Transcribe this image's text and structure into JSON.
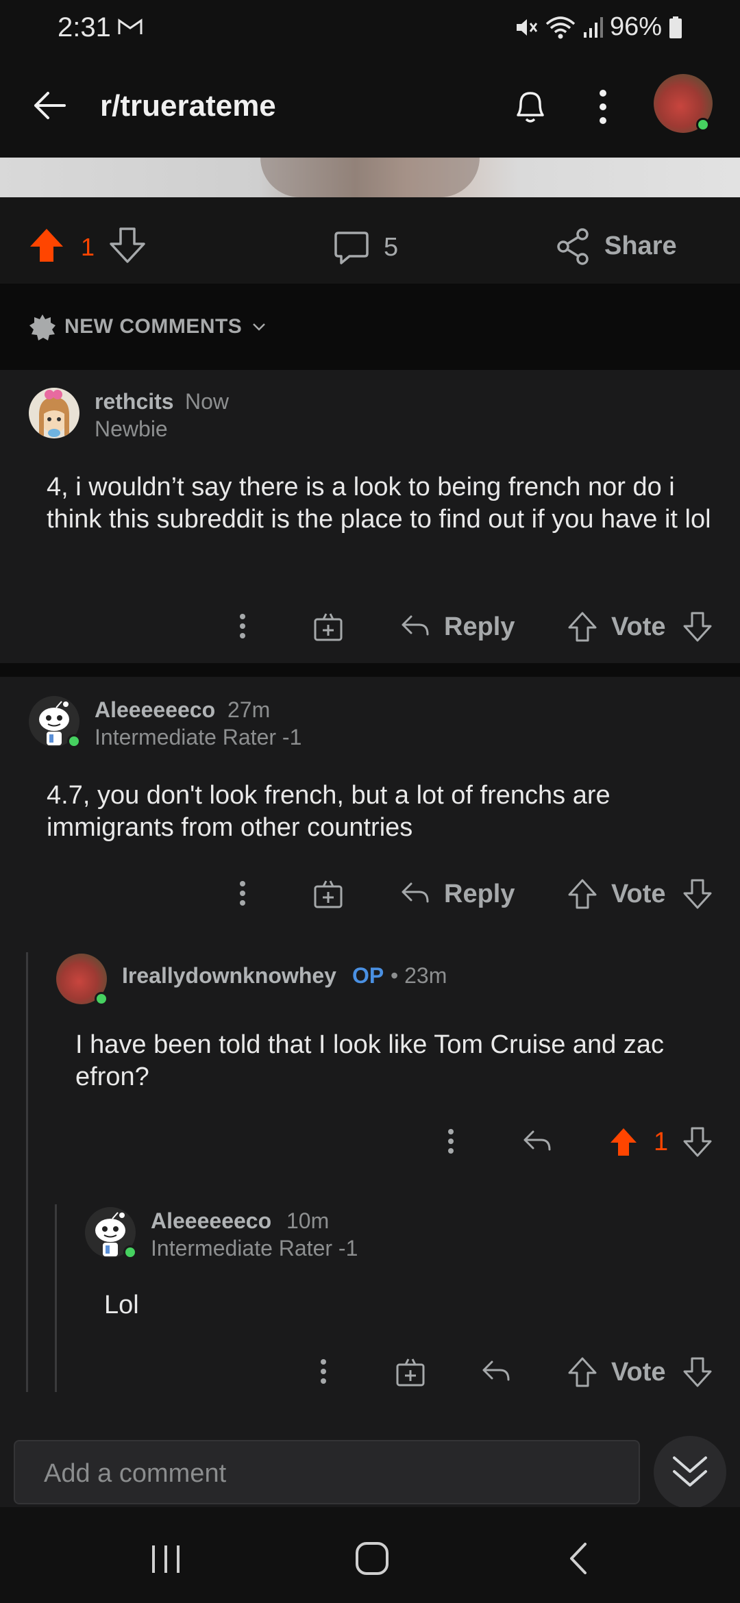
{
  "status_bar": {
    "time": "2:31",
    "battery": "96%"
  },
  "header": {
    "title": "r/truerateme"
  },
  "post_actions": {
    "vote_count": "1",
    "comment_count": "5",
    "share_label": "Share"
  },
  "sort": {
    "label": "NEW COMMENTS"
  },
  "comments": [
    {
      "username": "rethcits",
      "time": "Now",
      "flair": "Newbie",
      "body": "4, i wouldn’t say there is a look to being french nor do i think this subreddit is the place to find out if you have it lol",
      "reply_label": "Reply",
      "vote_label": "Vote"
    },
    {
      "username": "Aleeeeeeco",
      "time": "27m",
      "flair": "Intermediate Rater -1",
      "body": "4.7, you don't look french, but a lot of frenchs are immigrants from other countries",
      "reply_label": "Reply",
      "vote_label": "Vote"
    },
    {
      "username": "Ireallydownknowhey",
      "op_badge": "OP",
      "time": "• 23m",
      "body": "I have been told that I look like Tom Cruise and zac efron?",
      "vote_count": "1"
    },
    {
      "username": "Aleeeeeeco",
      "time": "10m",
      "flair": "Intermediate Rater -1",
      "body": "Lol",
      "vote_label": "Vote"
    }
  ],
  "composer": {
    "placeholder": "Add a comment"
  },
  "colors": {
    "upvote": "#ff4500",
    "op": "#4a90e2",
    "online": "#46d160",
    "background": "#1a1a1b"
  }
}
